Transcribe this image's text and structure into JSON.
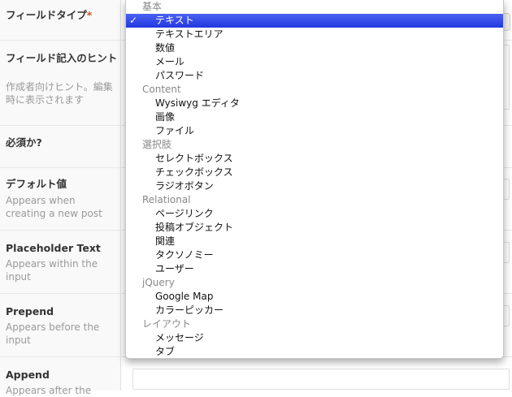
{
  "fields": {
    "field_type": {
      "label": "フィールドタイプ",
      "required_mark": "*"
    },
    "instructions": {
      "label": "フィールド記入のヒント",
      "hint": "作成者向けヒント。編集時に表示されます"
    },
    "required": {
      "label": "必須か?"
    },
    "default_value": {
      "label": "デフォルト値",
      "hint": "Appears when creating a new post"
    },
    "placeholder": {
      "label": "Placeholder Text",
      "hint": "Appears within the input"
    },
    "prepend": {
      "label": "Prepend",
      "hint": "Appears before the input"
    },
    "append": {
      "label": "Append",
      "hint": "Appears after the"
    }
  },
  "dropdown": {
    "selected": "テキスト",
    "check_mark": "✓",
    "groups": [
      {
        "label": "基本",
        "options": [
          "テキスト",
          "テキストエリア",
          "数値",
          "メール",
          "パスワード"
        ]
      },
      {
        "label": "Content",
        "options": [
          "Wysiwyg エディタ",
          "画像",
          "ファイル"
        ]
      },
      {
        "label": "選択肢",
        "options": [
          "セレクトボックス",
          "チェックボックス",
          "ラジオボタン"
        ]
      },
      {
        "label": "Relational",
        "options": [
          "ページリンク",
          "投稿オブジェクト",
          "関連",
          "タクソノミー",
          "ユーザー"
        ]
      },
      {
        "label": "jQuery",
        "options": [
          "Google Map",
          "カラーピッカー"
        ]
      },
      {
        "label": "レイアウト",
        "options": [
          "メッセージ",
          "タブ"
        ]
      }
    ]
  }
}
